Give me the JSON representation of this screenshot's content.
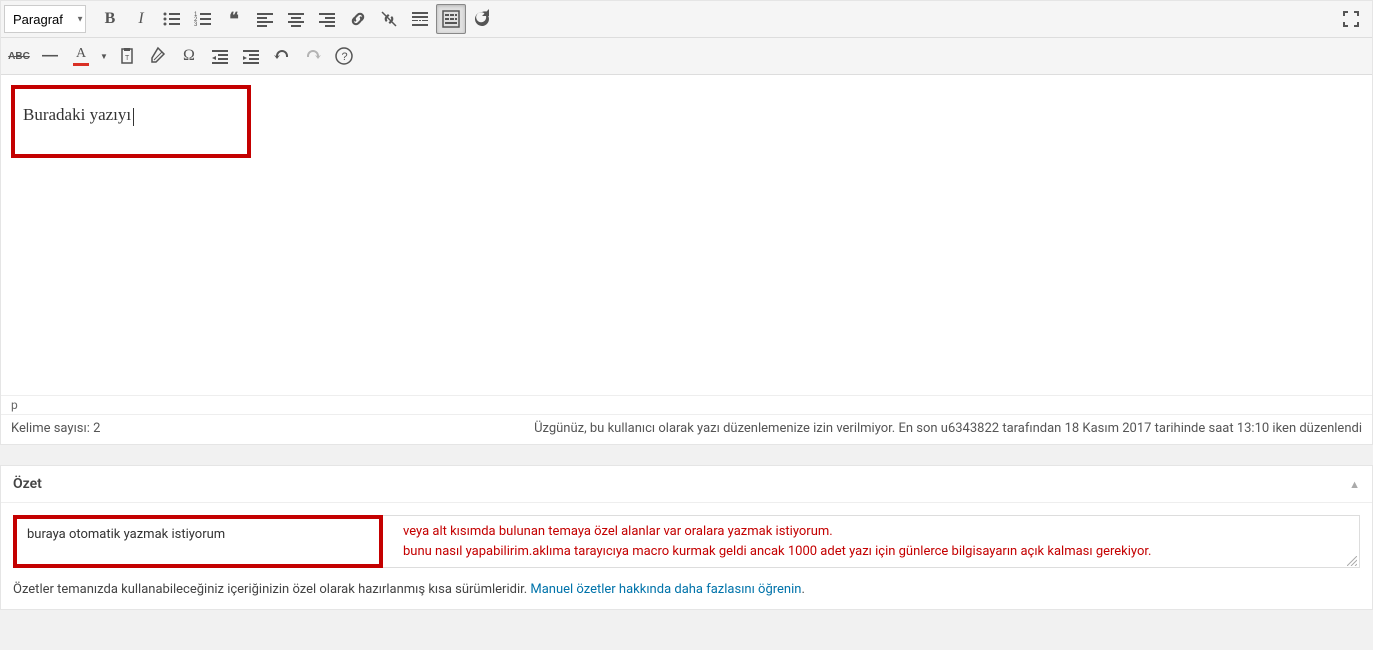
{
  "toolbar": {
    "format_select": "Paragraf",
    "buttons_row1": {
      "bold": "B",
      "italic": "I",
      "ul": "bullet-list",
      "ol": "numbered-list",
      "blockquote": "❝",
      "align_left": "align-left",
      "align_center": "align-center",
      "align_right": "align-right",
      "link": "link",
      "unlink": "unlink",
      "more": "read-more",
      "toolbar_toggle": "toolbar-toggle",
      "refresh": "refresh"
    },
    "buttons_row2": {
      "abc": "ABC",
      "hr": "—",
      "textcolor": "A",
      "paste": "paste",
      "clear": "clear-format",
      "omega": "Ω",
      "outdent": "outdent",
      "indent": "indent",
      "undo": "undo",
      "redo": "redo",
      "help": "?"
    }
  },
  "editor": {
    "content_text": "Buradaki yazıyı",
    "path": "p"
  },
  "status": {
    "word_count_label": "Kelime sayısı: 2",
    "right_text": "Üzgünüz, bu kullanıcı olarak yazı düzenlemenize izin verilmiyor. En son u6343822 tarafından 18 Kasım 2017 tarihinde saat 13:10 iken düzenlendi"
  },
  "excerpt": {
    "title": "Özet",
    "textarea_value": "buraya otomatik yazmak istiyorum",
    "annotation_line1": "veya alt kısımda bulunan temaya özel alanlar var oralara yazmak istiyorum.",
    "annotation_line2": "bunu nasıl yapabilirim.aklıma tarayıcıya macro kurmak geldi ancak 1000 adet yazı için günlerce bilgisayarın açık kalması gerekiyor.",
    "help_text": "Özetler temanızda kullanabileceğiniz içeriğinizin özel olarak hazırlanmış kısa sürümleridir. ",
    "help_link": "Manuel özetler hakkında daha fazlasını öğrenin",
    "help_after": "."
  }
}
